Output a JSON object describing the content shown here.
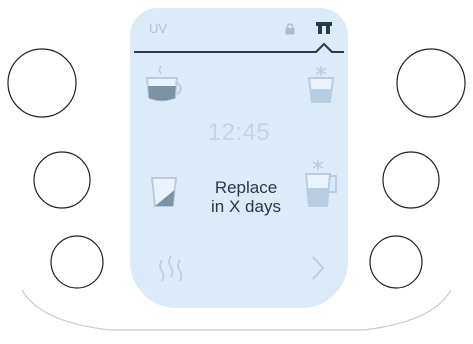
{
  "status_bar": {
    "mode_label": "UV",
    "lock_icon": "lock-icon",
    "filter_icon": "filter-icon"
  },
  "display": {
    "time": "12:45",
    "message": "Replace in X days"
  },
  "buttons": [
    "left-top",
    "left-middle",
    "left-bottom",
    "right-top",
    "right-middle",
    "right-bottom"
  ],
  "icons": [
    "cup-icon",
    "glass-cold-icon",
    "glass-half-icon",
    "jug-cold-icon",
    "steam-icon",
    "chevron-right-icon"
  ],
  "colors": {
    "screen_bg": "#dcebf7",
    "icon_fill": "#b8cee0",
    "icon_accent": "#7d93a5",
    "text_dark": "#253a4a",
    "text_light": "#c3d5e3"
  }
}
